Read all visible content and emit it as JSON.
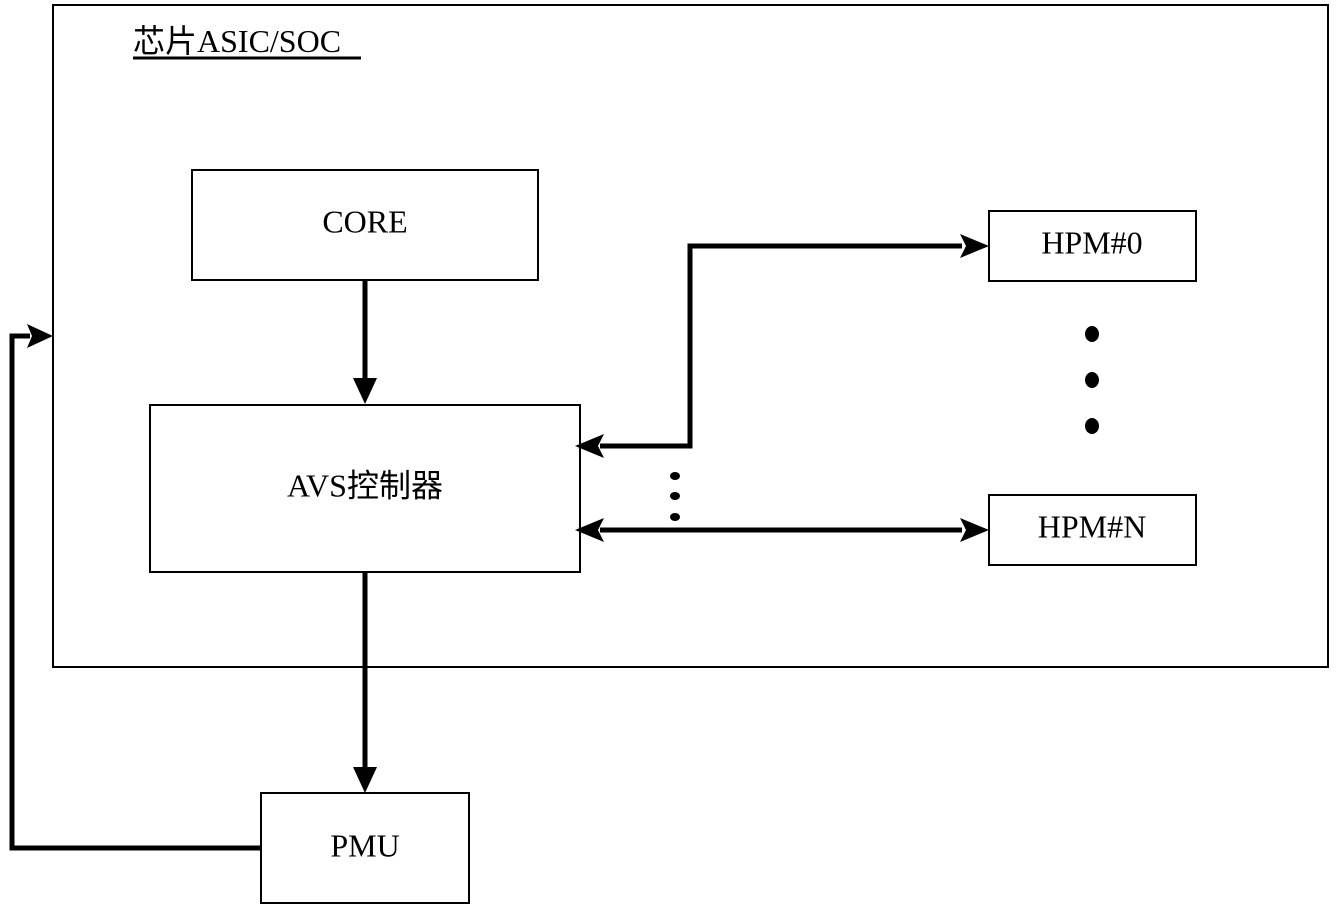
{
  "chip": {
    "title": "芯片ASIC/SOC"
  },
  "blocks": {
    "core": "CORE",
    "avs_controller": "AVS控制器",
    "hpm_first": "HPM#0",
    "hpm_last": "HPM#N",
    "pmu": "PMU"
  },
  "connections": [
    {
      "from": "CORE",
      "to": "AVS控制器",
      "direction": "one-way"
    },
    {
      "from": "AVS控制器",
      "to": "HPM#0",
      "direction": "bidirectional"
    },
    {
      "from": "AVS控制器",
      "to": "HPM#N",
      "direction": "bidirectional"
    },
    {
      "from": "AVS控制器",
      "to": "PMU",
      "direction": "one-way"
    },
    {
      "from": "PMU",
      "to": "芯片ASIC/SOC",
      "direction": "one-way"
    }
  ],
  "ellipsis": {
    "hpm_column": "⋮",
    "wire_column": "⋮"
  }
}
